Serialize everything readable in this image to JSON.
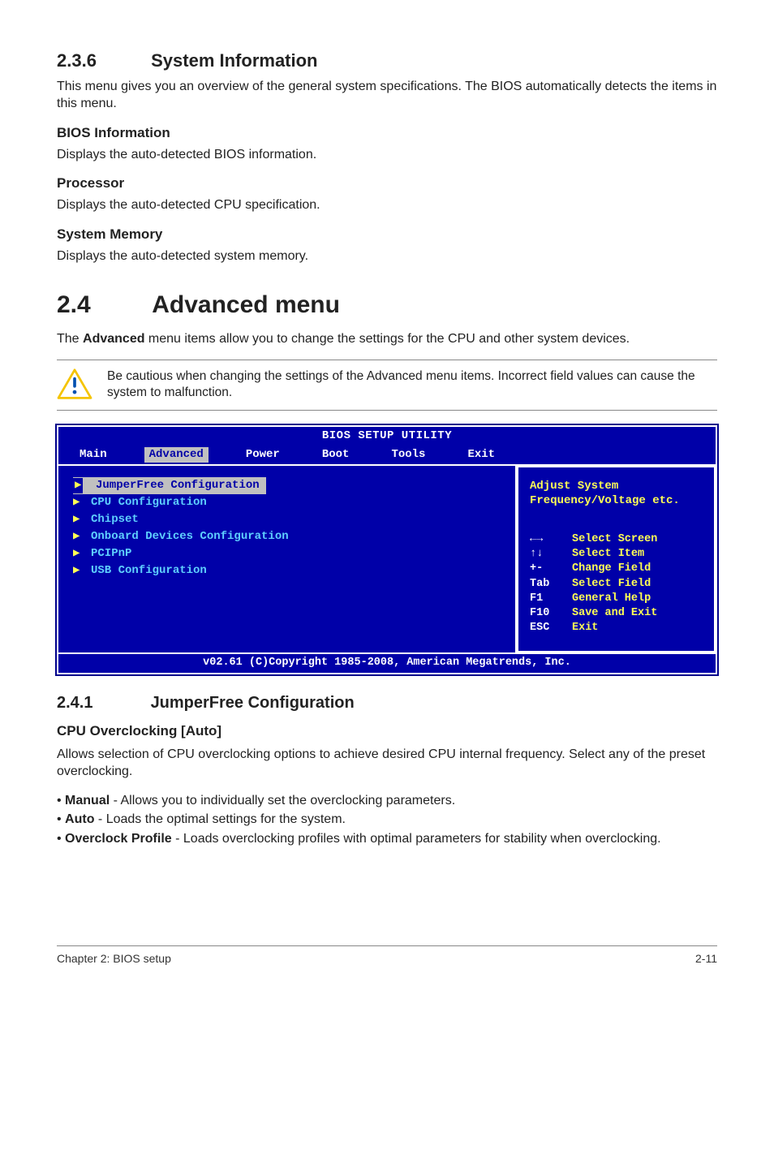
{
  "s236": {
    "num": "2.3.6",
    "title": "System Information",
    "intro": "This menu gives you an overview of the general system specifications. The BIOS automatically detects the items in this menu.",
    "bios_info_h": "BIOS Information",
    "bios_info_t": "Displays the auto-detected BIOS information.",
    "proc_h": "Processor",
    "proc_t": "Displays the auto-detected CPU specification.",
    "mem_h": "System Memory",
    "mem_t": "Displays the auto-detected system memory."
  },
  "s24": {
    "num": "2.4",
    "title": "Advanced menu",
    "intro_pre": "The ",
    "intro_bold": "Advanced",
    "intro_post": " menu items allow you to change the settings for the CPU and other system devices.",
    "note": "Be cautious when changing the settings of the Advanced menu items. Incorrect field values can cause the system to malfunction."
  },
  "bios": {
    "title": "BIOS SETUP UTILITY",
    "tabs": [
      "Main",
      "Advanced",
      "Power",
      "Boot",
      "Tools",
      "Exit"
    ],
    "active_tab_index": 1,
    "items": [
      "JumperFree Configuration",
      "CPU Configuration",
      "Chipset",
      "Onboard Devices Configuration",
      "PCIPnP",
      "USB Configuration"
    ],
    "selected_item_index": 0,
    "help_top": "Adjust System Frequency/Voltage etc.",
    "keys": [
      {
        "k": "←→",
        "d": "Select Screen"
      },
      {
        "k": "↑↓",
        "d": "Select Item"
      },
      {
        "k": "+-",
        "d": "Change Field"
      },
      {
        "k": "Tab",
        "d": "Select Field"
      },
      {
        "k": "F1",
        "d": "General Help"
      },
      {
        "k": "F10",
        "d": "Save and Exit"
      },
      {
        "k": "ESC",
        "d": "Exit"
      }
    ],
    "footer": "v02.61 (C)Copyright 1985-2008, American Megatrends, Inc."
  },
  "s241": {
    "num": "2.4.1",
    "title": "JumperFree Configuration",
    "field_h": "CPU Overclocking [Auto]",
    "field_t": "Allows selection of CPU overclocking options to achieve desired CPU internal frequency. Select any of the preset overclocking.",
    "opts": [
      {
        "b": "Manual",
        "t": " - Allows you to individually set the overclocking parameters."
      },
      {
        "b": "Auto",
        "t": " - Loads the optimal settings for the system."
      },
      {
        "b": "Overclock Profile",
        "t": " - Loads overclocking profiles with optimal parameters for stability when overclocking."
      }
    ]
  },
  "footer": {
    "left": "Chapter 2: BIOS setup",
    "right": "2-11"
  }
}
